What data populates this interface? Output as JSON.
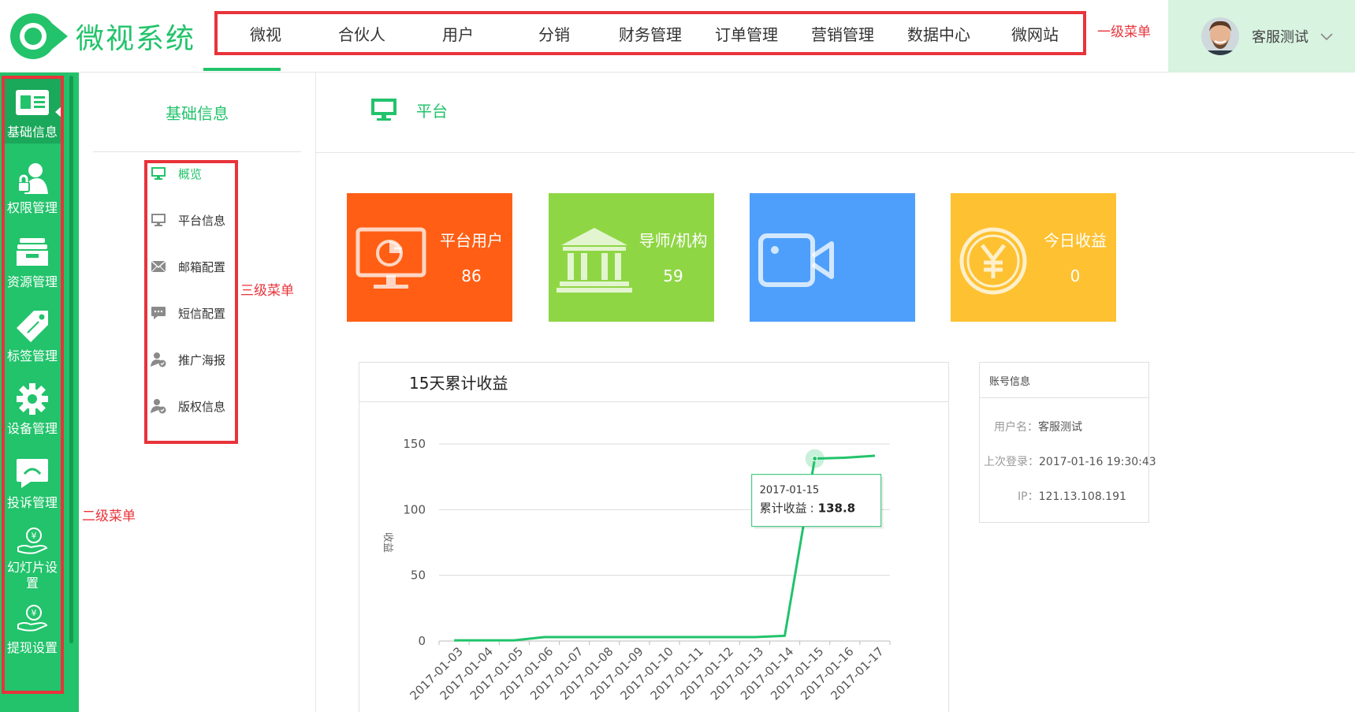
{
  "brand": {
    "name": "微视系统",
    "accent": "#22c36b",
    "annotation_color": "#e8333a"
  },
  "top_nav": {
    "items": [
      "微视",
      "合伙人",
      "用户",
      "分销",
      "财务管理",
      "订单管理",
      "营销管理",
      "数据中心",
      "微网站"
    ],
    "active_index": 0,
    "annotation": "一级菜单"
  },
  "user": {
    "name": "客服测试"
  },
  "sidebar": {
    "items": [
      {
        "label": "基础信息",
        "icon": "id-card-icon",
        "active": true
      },
      {
        "label": "权限管理",
        "icon": "user-lock-icon"
      },
      {
        "label": "资源管理",
        "icon": "inbox-icon"
      },
      {
        "label": "标签管理",
        "icon": "tag-icon"
      },
      {
        "label": "设备管理",
        "icon": "gear-icon"
      },
      {
        "label": "投诉管理",
        "icon": "chat-bubble-icon"
      },
      {
        "label": "幻灯片设置",
        "icon": "hand-coin-icon"
      },
      {
        "label": "提现设置",
        "icon": "hand-coin-icon"
      }
    ],
    "annotation": "二级菜单"
  },
  "subnav": {
    "title": "基础信息",
    "items": [
      {
        "label": "概览",
        "icon": "monitor-icon",
        "active": true
      },
      {
        "label": "平台信息",
        "icon": "monitor-icon"
      },
      {
        "label": "邮箱配置",
        "icon": "envelope-icon"
      },
      {
        "label": "短信配置",
        "icon": "sms-icon"
      },
      {
        "label": "推广海报",
        "icon": "user-check-icon"
      },
      {
        "label": "版权信息",
        "icon": "user-check-icon"
      }
    ],
    "annotation": "三级菜单"
  },
  "page": {
    "title": "平台",
    "icon": "monitor-icon"
  },
  "stats": [
    {
      "label": "平台用户",
      "value": "86",
      "color": "#ff5e14",
      "icon": "monitor-pie-icon"
    },
    {
      "label": "导师/机构",
      "value": "59",
      "color": "#8fd645",
      "icon": "institution-icon"
    },
    {
      "label": "",
      "value": "",
      "color": "#4e9ffb",
      "icon": "video-camera-icon"
    },
    {
      "label": "今日收益",
      "value": "0",
      "color": "#fec131",
      "icon": "yen-coin-icon"
    }
  ],
  "chart_panel_title": "15天累计收益",
  "chart_data": {
    "type": "line",
    "x": [
      "2017-01-03",
      "2017-01-04",
      "2017-01-05",
      "2017-01-06",
      "2017-01-07",
      "2017-01-08",
      "2017-01-09",
      "2017-01-10",
      "2017-01-11",
      "2017-01-12",
      "2017-01-13",
      "2017-01-14",
      "2017-01-15",
      "2017-01-16",
      "2017-01-17"
    ],
    "series": [
      {
        "name": "累计收益",
        "values": [
          0.5,
          0.5,
          0.5,
          3,
          3,
          3,
          3,
          3,
          3,
          3,
          3,
          4,
          138.8,
          139.5,
          141
        ]
      }
    ],
    "ylabel": "收益",
    "yticks": [
      0,
      50,
      100,
      150
    ],
    "ylim": [
      0,
      150
    ],
    "grid": true,
    "tooltip": {
      "x": "2017-01-15",
      "series_label": "累计收益",
      "value": "138.8"
    },
    "line_color": "#22c36b"
  },
  "account": {
    "title": "账号信息",
    "username_label": "用户名：",
    "username": "客服测试",
    "last_login_label": "上次登录：",
    "last_login": "2017-01-16 19:30:43",
    "ip_label": "IP：",
    "ip": "121.13.108.191"
  }
}
